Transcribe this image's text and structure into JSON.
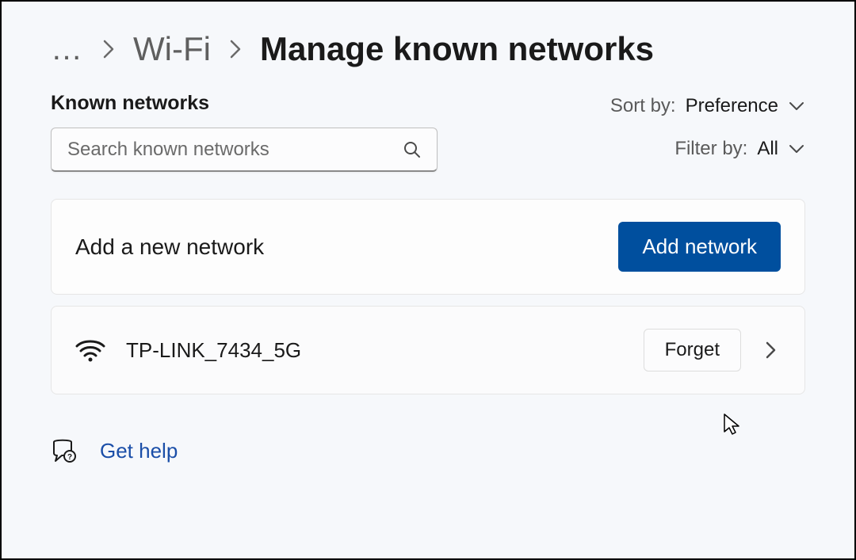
{
  "breadcrumb": {
    "ellipsis": "…",
    "parent": "Wi-Fi",
    "title": "Manage known networks"
  },
  "section": {
    "heading": "Known networks"
  },
  "search": {
    "placeholder": "Search known networks"
  },
  "sort": {
    "label": "Sort by:",
    "value": "Preference"
  },
  "filter": {
    "label": "Filter by:",
    "value": "All"
  },
  "add_card": {
    "label": "Add a new network",
    "button": "Add network"
  },
  "networks": [
    {
      "name": "TP-LINK_7434_5G",
      "forget": "Forget"
    }
  ],
  "help": {
    "label": "Get help"
  }
}
